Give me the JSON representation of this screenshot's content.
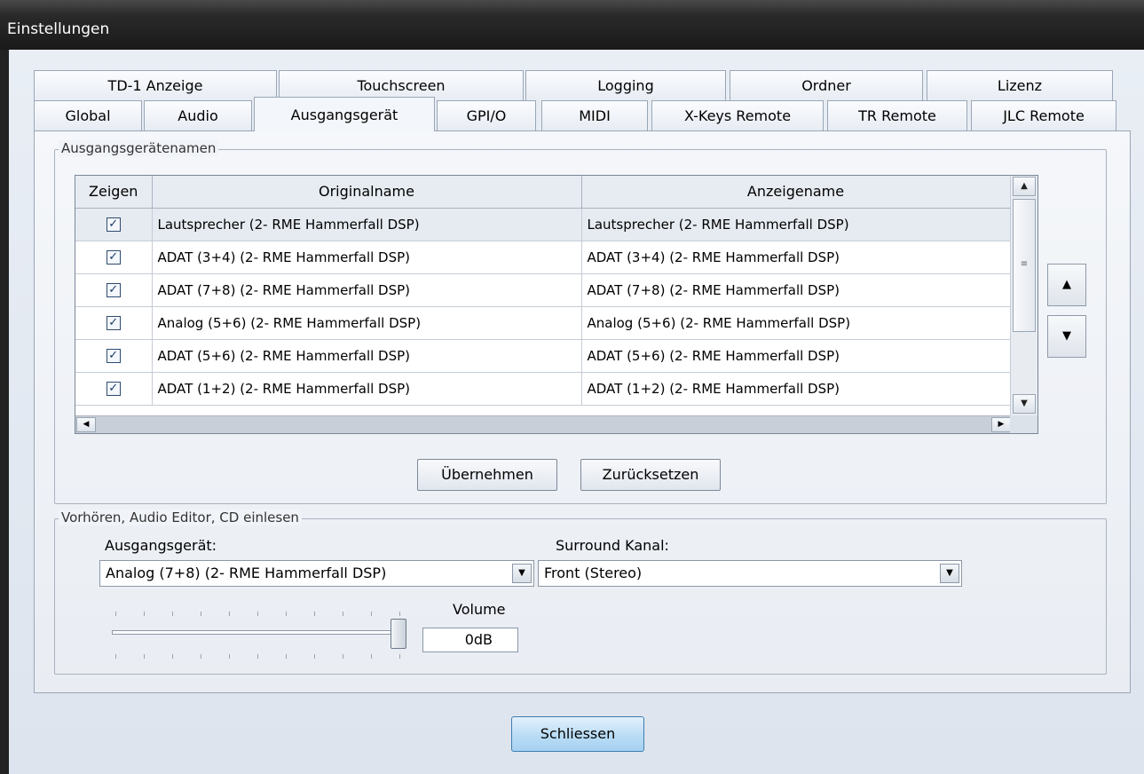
{
  "window": {
    "title": "Einstellungen"
  },
  "tabs": {
    "row_back": [
      "TD-1 Anzeige",
      "Touchscreen",
      "Logging",
      "Ordner",
      "Lizenz"
    ],
    "row_front": [
      "Global",
      "Audio",
      "Ausgangsgerät",
      "GPI/O",
      "MIDI",
      "X-Keys Remote",
      "TR Remote",
      "JLC Remote"
    ],
    "selected": "Ausgangsgerät"
  },
  "devices_group": {
    "legend": "Ausgangsgerätenamen",
    "columns": [
      "Zeigen",
      "Originalname",
      "Anzeigename"
    ],
    "rows": [
      {
        "show": true,
        "original": "Lautsprecher (2- RME Hammerfall DSP)",
        "display": "Lautsprecher (2- RME Hammerfall DSP)"
      },
      {
        "show": true,
        "original": "ADAT (3+4) (2- RME Hammerfall DSP)",
        "display": "ADAT (3+4) (2- RME Hammerfall DSP)"
      },
      {
        "show": true,
        "original": "ADAT (7+8) (2- RME Hammerfall DSP)",
        "display": "ADAT (7+8) (2- RME Hammerfall DSP)"
      },
      {
        "show": true,
        "original": "Analog (5+6) (2- RME Hammerfall DSP)",
        "display": "Analog (5+6) (2- RME Hammerfall DSP)"
      },
      {
        "show": true,
        "original": "ADAT (5+6) (2- RME Hammerfall DSP)",
        "display": "ADAT (5+6) (2- RME Hammerfall DSP)"
      },
      {
        "show": true,
        "original": "ADAT (1+2) (2- RME Hammerfall DSP)",
        "display": "ADAT (1+2) (2- RME Hammerfall DSP)"
      }
    ],
    "apply_label": "Übernehmen",
    "reset_label": "Zurücksetzen"
  },
  "preview_group": {
    "legend": "Vorhören, Audio Editor, CD einlesen",
    "output_label": "Ausgangsgerät:",
    "output_value": "Analog (7+8) (2- RME Hammerfall DSP)",
    "surround_label": "Surround Kanal:",
    "surround_value": "Front (Stereo)",
    "volume_label": "Volume",
    "volume_value": "0dB",
    "volume_level": 1.0
  },
  "footer": {
    "close_label": "Schliessen"
  },
  "icons": {
    "check": "✓",
    "up": "▲",
    "down": "▼",
    "left": "◀",
    "right": "▶",
    "grip": "≡"
  }
}
